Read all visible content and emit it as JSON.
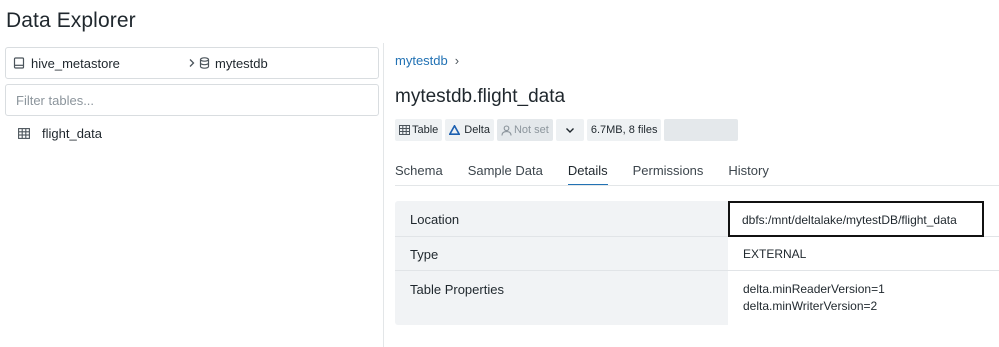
{
  "page": {
    "title": "Data Explorer"
  },
  "sidebar": {
    "catalog": "hive_metastore",
    "schema": "mytestdb",
    "filter_placeholder": "Filter tables...",
    "tables": [
      {
        "name": "flight_data"
      }
    ]
  },
  "main": {
    "breadcrumb": {
      "schema": "mytestdb",
      "separator": "›"
    },
    "table_title": "mytestdb.flight_data",
    "badges": {
      "type": "Table",
      "format": "Delta",
      "owner": "Not set",
      "size": "6.7MB, 8 files"
    },
    "tabs": [
      {
        "label": "Schema"
      },
      {
        "label": "Sample Data"
      },
      {
        "label": "Details",
        "active": true
      },
      {
        "label": "Permissions"
      },
      {
        "label": "History"
      }
    ],
    "details": {
      "location_label": "Location",
      "location_value": "dbfs:/mnt/deltalake/mytestDB/flight_data",
      "type_label": "Type",
      "type_value": "EXTERNAL",
      "props_label": "Table Properties",
      "props_values": [
        "delta.minReaderVersion=1",
        "delta.minWriterVersion=2"
      ]
    }
  },
  "colors": {
    "accent": "#2272b4",
    "delta": "#1b5fb0",
    "text": "#1f272d"
  },
  "icons": [
    "catalog-icon",
    "chevron-right-icon",
    "database-icon",
    "table-icon",
    "delta-icon",
    "user-icon",
    "chevron-down-icon"
  ]
}
